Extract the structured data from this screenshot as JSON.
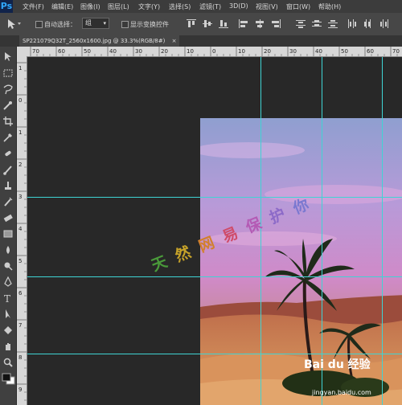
{
  "app": {
    "logo": "Ps"
  },
  "menu": [
    "文件(F)",
    "编辑(E)",
    "图像(I)",
    "图层(L)",
    "文字(Y)",
    "选择(S)",
    "滤镜(T)",
    "3D(D)",
    "视图(V)",
    "窗口(W)",
    "帮助(H)"
  ],
  "options": {
    "auto_select_label": "自动选择：",
    "auto_select_value": "组",
    "show_transform_label": "显示变换控件"
  },
  "document": {
    "tab_title": "SP221079Q32T_2560x1600.jpg @ 33.3%(RGB/8#)",
    "close": "×"
  },
  "ruler_top": [
    "70",
    "60",
    "50",
    "40",
    "30",
    "20",
    "10",
    "0",
    "10",
    "20",
    "30",
    "40",
    "50",
    "60",
    "70"
  ],
  "ruler_left": [
    "1",
    "0",
    "1",
    "2",
    "3",
    "4",
    "5",
    "6",
    "7",
    "8",
    "9"
  ],
  "watermark": {
    "chars": [
      {
        "text": "天",
        "color": "#4a9a3a"
      },
      {
        "text": "然",
        "color": "#c7a329"
      },
      {
        "text": "网",
        "color": "#d2802c"
      },
      {
        "text": "易",
        "color": "#cf4c6a"
      },
      {
        "text": "保",
        "color": "#b45ab4"
      },
      {
        "text": "护",
        "color": "#8c6ac8"
      },
      {
        "text": "你",
        "color": "#7a78d0"
      }
    ]
  },
  "baidu": {
    "brand": "Bai du 经验",
    "url": "jingyan.baidu.com"
  },
  "colors": {
    "guide": "#3fd4d4",
    "menubar": "#3c3c3c",
    "panel": "#474747",
    "canvas_bg": "#282828"
  }
}
